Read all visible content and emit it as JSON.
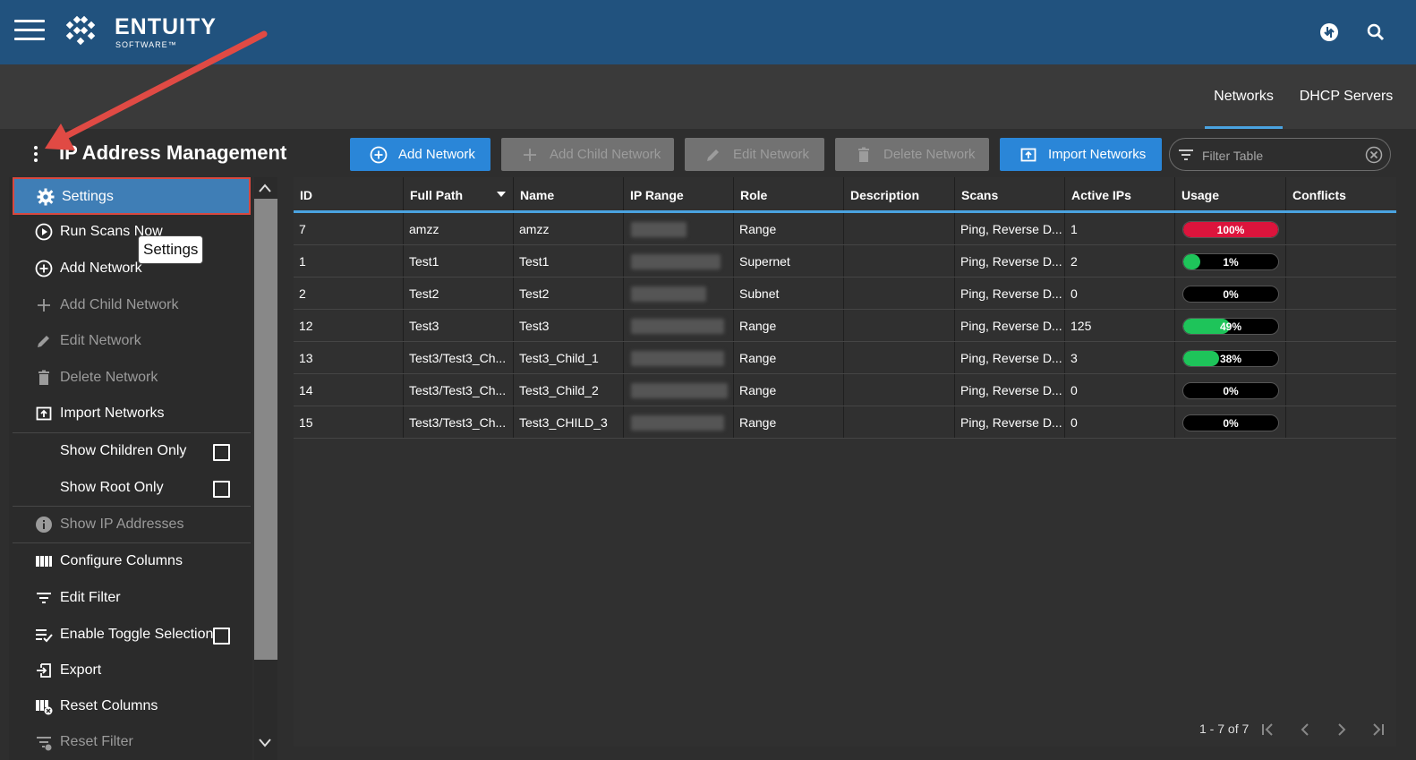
{
  "app": {
    "brand": "ENTUITY",
    "brand_sub": "SOFTWARE™",
    "colors": {
      "header": "#21527e",
      "accent": "#2a86d8",
      "danger": "#dc143c",
      "success": "#1ec45a",
      "highlight_border": "#d8483f"
    }
  },
  "tabs": [
    {
      "label": "Networks",
      "active": true
    },
    {
      "label": "DHCP Servers",
      "active": false
    }
  ],
  "page": {
    "title": "IP Address Management"
  },
  "toolbar": {
    "add_network": "Add Network",
    "add_child_network": "Add Child Network",
    "edit_network": "Edit Network",
    "delete_network": "Delete Network",
    "import_networks": "Import Networks",
    "filter_placeholder": "Filter Table"
  },
  "menu": {
    "items": [
      {
        "label": "Settings",
        "icon": "gear-icon"
      },
      {
        "label": "Run Scans Now",
        "icon": "play-circle-icon"
      },
      {
        "label": "Add Network",
        "icon": "plus-circle-icon"
      },
      {
        "label": "Add Child Network",
        "icon": "plus-icon"
      },
      {
        "label": "Edit Network",
        "icon": "pencil-icon"
      },
      {
        "label": "Delete Network",
        "icon": "trash-icon"
      },
      {
        "label": "Import Networks",
        "icon": "import-icon"
      },
      {
        "label": "Show Children Only",
        "checked": false
      },
      {
        "label": "Show Root Only",
        "checked": false
      },
      {
        "label": "Show IP Addresses",
        "icon": "info-icon"
      },
      {
        "label": "Configure Columns",
        "icon": "columns-icon"
      },
      {
        "label": "Edit Filter",
        "icon": "filter-icon"
      },
      {
        "label": "Enable Toggle Selection",
        "icon": "toggle-selection-icon",
        "checked": false
      },
      {
        "label": "Export",
        "icon": "export-icon"
      },
      {
        "label": "Reset Columns",
        "icon": "reset-columns-icon"
      },
      {
        "label": "Reset Filter",
        "icon": "reset-filter-icon"
      }
    ],
    "tooltip": "Settings"
  },
  "table": {
    "columns": [
      "ID",
      "Full Path",
      "Name",
      "IP Range",
      "Role",
      "Description",
      "Scans",
      "Active IPs",
      "Usage",
      "Conflicts"
    ],
    "rows": [
      {
        "id": "7",
        "full_path": "amzz",
        "name": "amzz",
        "role": "Range",
        "description": "",
        "scans": "Ping, Reverse D...",
        "active_ips": "1",
        "usage": 100,
        "usage_label": "100%",
        "conflicts": ""
      },
      {
        "id": "1",
        "full_path": "Test1",
        "name": "Test1",
        "role": "Supernet",
        "description": "",
        "scans": "Ping, Reverse D...",
        "active_ips": "2",
        "usage": 1,
        "usage_label": "1%",
        "conflicts": ""
      },
      {
        "id": "2",
        "full_path": "Test2",
        "name": "Test2",
        "role": "Subnet",
        "description": "",
        "scans": "Ping, Reverse D...",
        "active_ips": "0",
        "usage": 0,
        "usage_label": "0%",
        "conflicts": ""
      },
      {
        "id": "12",
        "full_path": "Test3",
        "name": "Test3",
        "role": "Range",
        "description": "",
        "scans": "Ping, Reverse D...",
        "active_ips": "125",
        "usage": 49,
        "usage_label": "49%",
        "conflicts": ""
      },
      {
        "id": "13",
        "full_path": "Test3/Test3_Ch...",
        "name": "Test3_Child_1",
        "role": "Range",
        "description": "",
        "scans": "Ping, Reverse D...",
        "active_ips": "3",
        "usage": 38,
        "usage_label": "38%",
        "conflicts": ""
      },
      {
        "id": "14",
        "full_path": "Test3/Test3_Ch...",
        "name": "Test3_Child_2",
        "role": "Range",
        "description": "",
        "scans": "Ping, Reverse D...",
        "active_ips": "0",
        "usage": 0,
        "usage_label": "0%",
        "conflicts": ""
      },
      {
        "id": "15",
        "full_path": "Test3/Test3_Ch...",
        "name": "Test3_CHILD_3",
        "role": "Range",
        "description": "",
        "scans": "Ping, Reverse D...",
        "active_ips": "0",
        "usage": 0,
        "usage_label": "0%",
        "conflicts": ""
      }
    ],
    "pagination": "1 - 7 of 7"
  }
}
